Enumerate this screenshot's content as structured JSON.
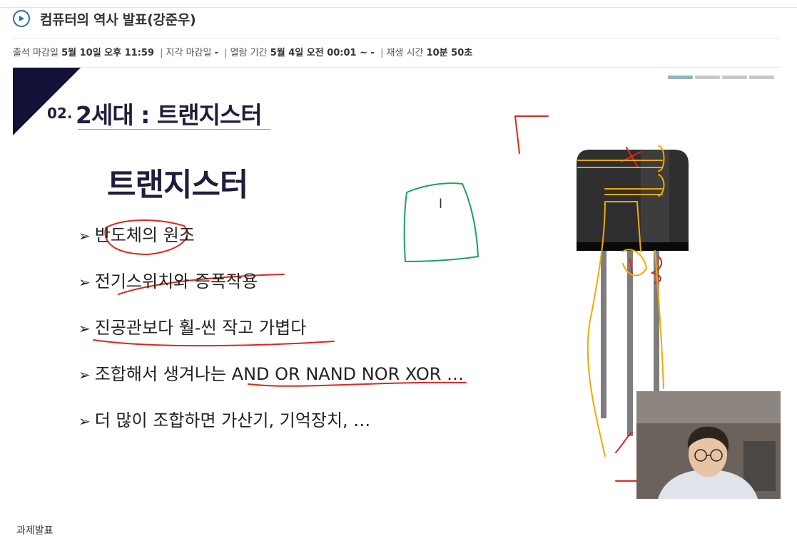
{
  "header": {
    "title": "컴퓨터의 역사 발표(강준우)",
    "play_icon": "play-circle-icon",
    "accent": "#2b6cb0"
  },
  "meta": {
    "attendance_label": "출석 마감일",
    "attendance_value": "5월 10일 오후 11:59",
    "late_label": "지각 마감일",
    "late_value": "-",
    "view_label": "열람 기간",
    "view_value": "5월 4일 오전 00:01 ~ -",
    "play_label": "재생 시간",
    "play_value": "10분 50초"
  },
  "slide": {
    "section_number": "02.",
    "section_title": "2세대 : 트랜지스터",
    "heading": "트랜지스터",
    "bullets": [
      "반도체의 원조",
      "전기스위치와 증폭작용",
      "진공관보다 훨-씬 작고 가볍다",
      "조합해서 생겨나는 AND OR NAND NOR XOR …",
      "더 많이 조합하면 가산기, 기억장치, …"
    ],
    "bullet_marker": "➢",
    "annotation_mark": "l",
    "colors": {
      "navy": "#1e1e3c",
      "red_ink": "#e0261b",
      "orange_ink": "#f2a900",
      "green_ink": "#1aa35a"
    }
  },
  "footer": {
    "label": "과제발표"
  }
}
